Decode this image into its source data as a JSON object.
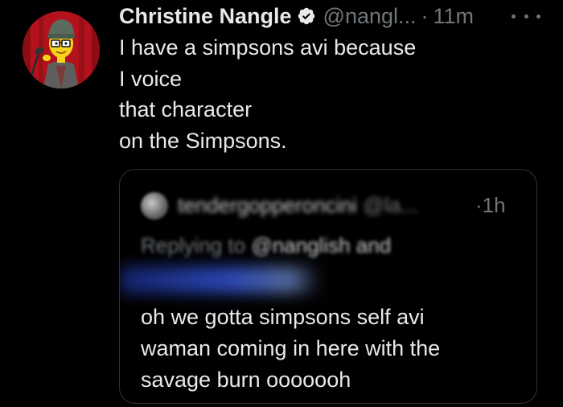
{
  "tweet": {
    "author": {
      "display_name": "Christine Nangle",
      "handle": "@nangl...",
      "verified": true
    },
    "separator": "·",
    "time": "11m",
    "text_lines": [
      "I have a simpsons avi because",
      "I voice",
      "that character",
      "on the Simpsons."
    ]
  },
  "quote": {
    "author_name": "tendergopperoncini",
    "author_handle": "@la...",
    "separator": "·",
    "time": "1h",
    "replying_prefix": "Replying to",
    "replying_names": "@nanglish",
    "replying_and": "and",
    "text_lines": [
      "oh we gotta simpsons self avi",
      "waman coming in here with the",
      "savage burn ooooooh"
    ]
  },
  "colors": {
    "background": "#000000",
    "text_primary": "#e7e9ea",
    "text_secondary": "#71767b",
    "verified_badge": "#e7e9ea",
    "card_border": "#2f3336",
    "avatar_background": "#b3121c"
  },
  "icons": {
    "verified": "verified-badge-icon",
    "more": "more-options-icon"
  }
}
